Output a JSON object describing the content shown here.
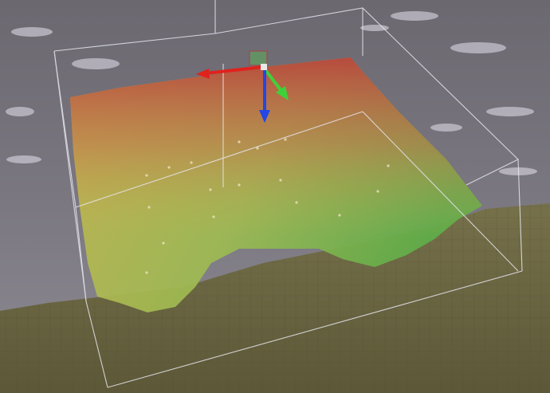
{
  "scene": {
    "colors": {
      "water_top": "#6b6870",
      "water_bottom": "#8a8790",
      "ground": "#6e6a45",
      "ground_dark": "#5a5838",
      "volume_red": "#c0483e",
      "volume_yellow": "#c9b84e",
      "volume_green": "#5fae4a",
      "bounds": "#e8e8ee",
      "gizmo_x": "#e0221c",
      "gizmo_y": "#3ed13a",
      "gizmo_z": "#2247e6"
    },
    "icons": {
      "gizmo": "transform-gizmo-icon"
    }
  }
}
